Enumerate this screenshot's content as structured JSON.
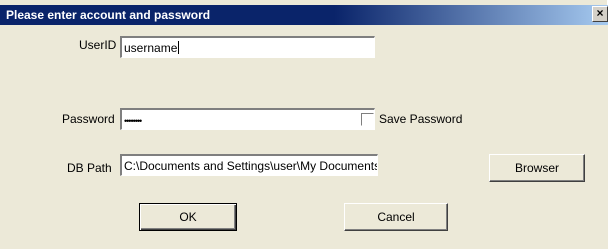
{
  "window": {
    "title": "Please enter account and password",
    "close_glyph": "×"
  },
  "form": {
    "userid_label": "UserID",
    "userid_value": "username",
    "password_label": "Password",
    "password_value": "••••••••",
    "save_password_label": "Save Password",
    "save_password_checked": false,
    "dbpath_label": "DB Path",
    "dbpath_value": "C:\\Documents and Settings\\user\\My Documents\\ACT\\ACT for Wind"
  },
  "buttons": {
    "browser": "Browser",
    "ok": "OK",
    "cancel": "Cancel"
  }
}
